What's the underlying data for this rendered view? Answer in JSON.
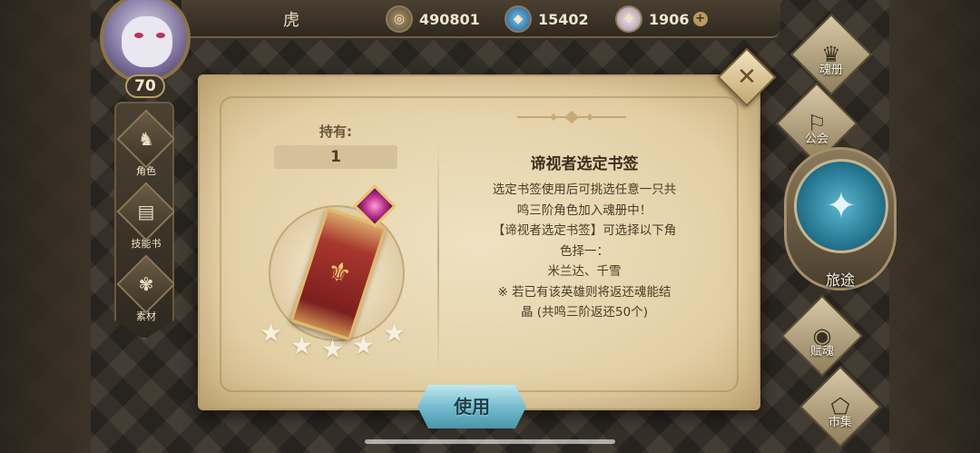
{
  "player": {
    "name": "虎",
    "level": "70"
  },
  "currencies": [
    {
      "icon": "coin-icon",
      "value": "490801"
    },
    {
      "icon": "crystal-icon",
      "value": "15402"
    },
    {
      "icon": "gem-icon",
      "value": "1906"
    }
  ],
  "left_nav": [
    {
      "label": "角色",
      "icon": "helmet-icon"
    },
    {
      "label": "技能书",
      "icon": "book-icon"
    },
    {
      "label": "素材",
      "icon": "material-icon"
    }
  ],
  "right_nav": {
    "soul_book": "魂册",
    "guild": "公会",
    "journey": "旅途",
    "tribute": "赋魂",
    "market": "市集"
  },
  "modal": {
    "own_label": "持有:",
    "own_count": "1",
    "title": "谛视者选定书签",
    "desc_lines": [
      "选定书签使用后可挑选任意一只共",
      "鸣三阶角色加入魂册中！",
      "【谛视者选定书签】可选择以下角",
      "色择一：",
      "米兰达、千雪",
      "※ 若已有该英雄则将返还魂能结",
      "晶 (共鸣三阶返还50个)"
    ],
    "stars": 5,
    "use_button": "使用"
  },
  "colors": {
    "accent_blue": "#6fb9cb",
    "parchment": "#e2cfa4"
  }
}
